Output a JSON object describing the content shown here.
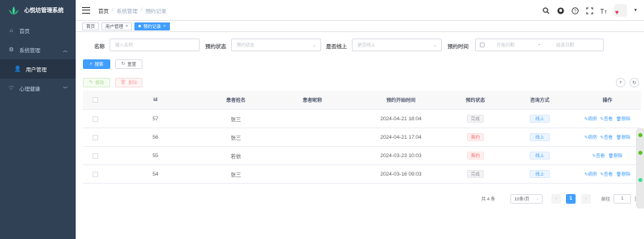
{
  "app": {
    "title": "心悦坊管理系统",
    "brand_color": "#304156",
    "accent": "#409eff"
  },
  "sidebar": {
    "items": [
      {
        "label": "首页",
        "icon": "home-icon"
      },
      {
        "label": "系统管理",
        "icon": "gear-icon",
        "expanded": true
      },
      {
        "label": "用户管理",
        "icon": "user-icon",
        "active": true
      },
      {
        "label": "心理健康",
        "icon": "heart-pulse-icon"
      }
    ]
  },
  "navbar": {
    "breadcrumb": [
      "首页",
      "系统管理",
      "预约记录"
    ],
    "icons": [
      "search-icon",
      "github-icon",
      "question-icon",
      "fullscreen-icon",
      "font-size-icon"
    ]
  },
  "tags": [
    {
      "label": "首页"
    },
    {
      "label": "用户管理"
    },
    {
      "label": "预约记录",
      "active": true
    }
  ],
  "search": {
    "name_label": "名称",
    "name_placeholder": "输入名称",
    "status_label": "预约状态",
    "status_placeholder": "预约状态",
    "online_label": "是否线上",
    "online_placeholder": "是否线上",
    "time_label": "预约时间",
    "start_placeholder": "开始日期",
    "date_sep": "-",
    "end_placeholder": "结束日期",
    "search_button": "搜索",
    "reset_button": "重置"
  },
  "toolbar": {
    "edit_button": "修改",
    "delete_button": "删除"
  },
  "table": {
    "headers": [
      "id",
      "患者姓名",
      "患者昵称",
      "预约开始时间",
      "预约状态",
      "咨询方式",
      "操作"
    ],
    "rows": [
      {
        "id": "57",
        "name": "张三",
        "nickname": "",
        "time": "2024-04-21 18:04",
        "status": "完成",
        "status_color": "gray",
        "method": "线上",
        "ops": [
          "病例",
          "查看",
          "删除"
        ]
      },
      {
        "id": "56",
        "name": "张三",
        "nickname": "",
        "time": "2024-04-21 17:04",
        "status": "爽约",
        "status_color": "red",
        "method": "线上",
        "ops": [
          "病例",
          "查看",
          "删除"
        ]
      },
      {
        "id": "55",
        "name": "若依",
        "nickname": "",
        "time": "2024-03-23 10:03",
        "status": "爽约",
        "status_color": "red",
        "method": "线上",
        "ops": [
          "查看",
          "删除"
        ]
      },
      {
        "id": "54",
        "name": "张三",
        "nickname": "",
        "time": "2024-03-16 09:03",
        "status": "完成",
        "status_color": "gray",
        "method": "线上",
        "ops": [
          "病例",
          "查看",
          "删除"
        ]
      }
    ]
  },
  "pagination": {
    "total": "共 4 条",
    "page_size": "10条/页",
    "current": "1",
    "goto_label": "前往",
    "goto_value": "1",
    "page_suffix": "页"
  }
}
